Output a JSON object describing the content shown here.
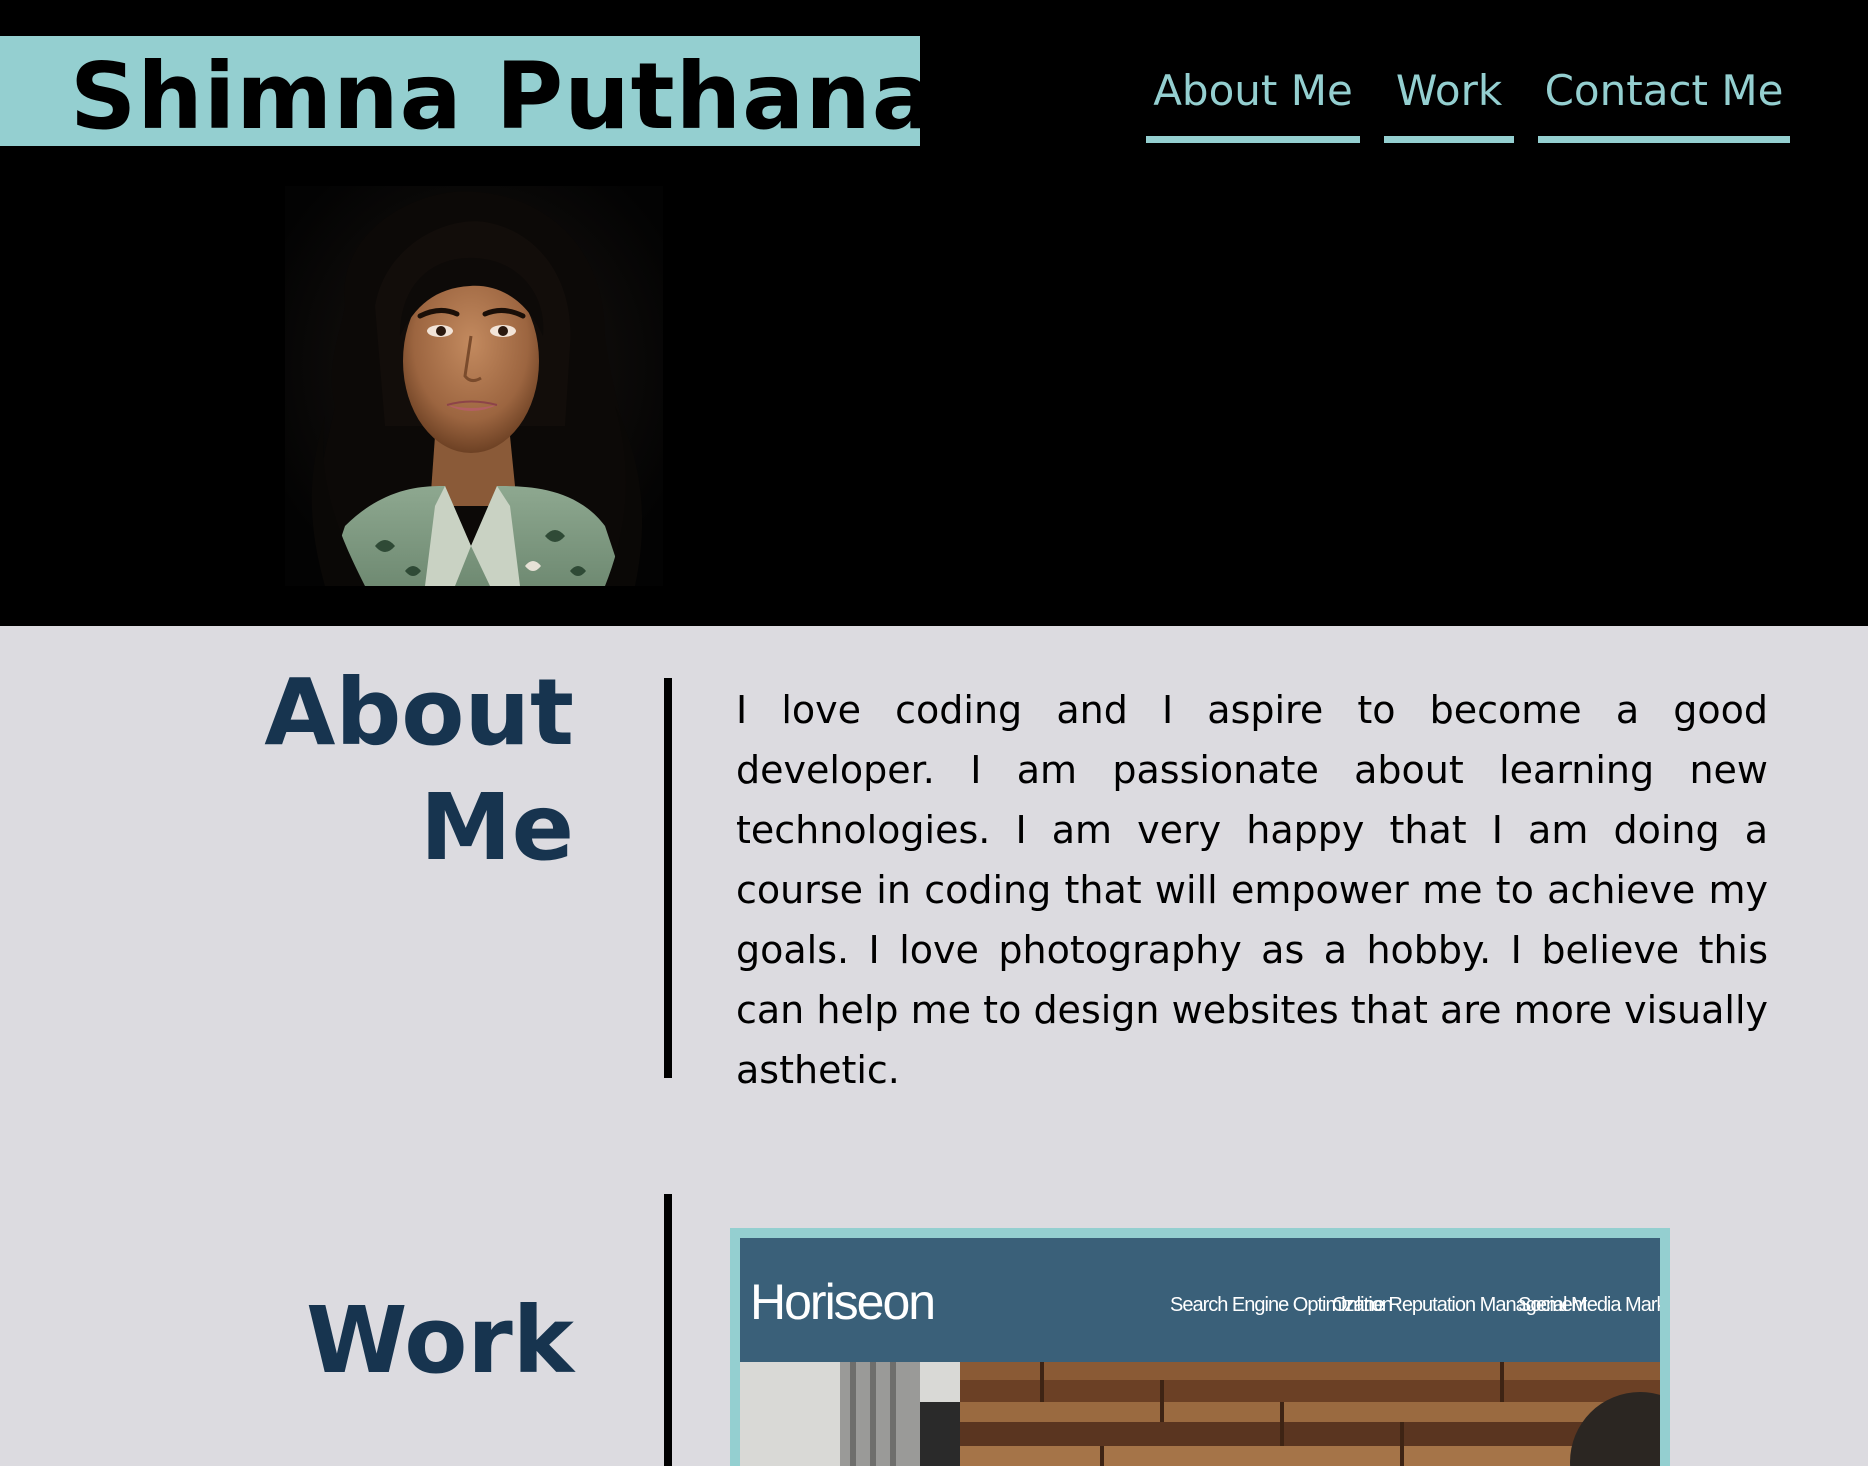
{
  "header": {
    "name": "Shimna Puthanayil",
    "nav": [
      {
        "label": "About Me"
      },
      {
        "label": "Work"
      },
      {
        "label": "Contact Me"
      }
    ]
  },
  "about": {
    "title_line1": "About",
    "title_line2": "Me",
    "text": "I love coding and I aspire to become a good developer. I am passionate about learning new technologies. I am very happy that I am doing a course in coding that will empower me to achieve my goals. I love photography as a hobby. I believe this can help me to design websites that are more visually asthetic."
  },
  "work": {
    "title": "Work",
    "project": {
      "logo_text": "Horiseon",
      "nav": [
        "Search Engine Optimization",
        "Online Reputation Management",
        "Social Media Marketing"
      ]
    }
  },
  "colors": {
    "accent": "#94cfd0",
    "header_bg": "#000000",
    "page_bg": "#dcdbe0",
    "title": "#17344f",
    "project_bar": "#3a6079"
  }
}
